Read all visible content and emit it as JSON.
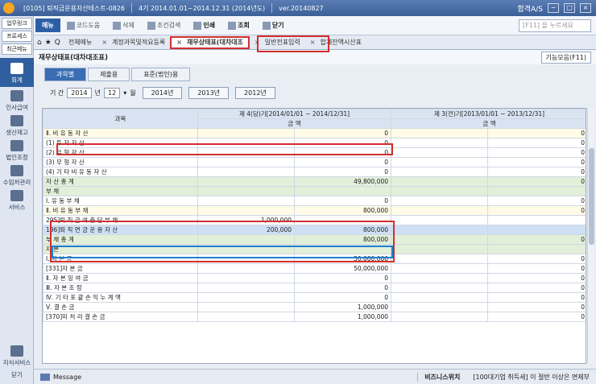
{
  "titlebar": {
    "company": "[0105] 퇴직금운용자산테스트-0826",
    "period": "4기 2014.01.01~2014.12.31 (2014년도)",
    "version": "ver.20140827",
    "right": "합격A/S"
  },
  "sidebar": {
    "top_buttons": [
      "업무링크",
      "프로세스",
      "최근메뉴"
    ],
    "items": [
      "회계",
      "인사급여",
      "생산재고",
      "법인조정",
      "수임처관리",
      "서비스"
    ],
    "bottom": [
      "지식서비스",
      "닫기"
    ]
  },
  "toolbar": {
    "menu": "메뉴",
    "items": [
      "코드도움",
      "삭제",
      "조건검색",
      "인쇄",
      "조회",
      "닫기"
    ],
    "search_placeholder": "[F11] 을 누르세요"
  },
  "tabs": [
    "전체메뉴",
    "계정과목및적요등록",
    "재무상태표(대차대조",
    "일반전표입력",
    "합계잔액시산표"
  ],
  "content": {
    "title": "재무상태표(대차대조표)",
    "func": "기능모음(F11)",
    "subtabs": [
      "과목별",
      "제출용",
      "표준(법인)용"
    ]
  },
  "period": {
    "label": "기   간",
    "year": "2014",
    "year_unit": "년",
    "month": "12",
    "month_unit": "월",
    "years": [
      "2014년",
      "2013년",
      "2012년"
    ]
  },
  "grid": {
    "headers": {
      "account": "과목",
      "cur": "제 4(당)기[2014/01/01 ~ 2014/12/31]",
      "prev": "제 3(전)기[2013/01/01 ~ 2013/12/31]",
      "amt": "금                  액"
    },
    "rows": [
      {
        "acct": "Ⅱ. 비   유   동   자   산",
        "a1": "",
        "a2": "0",
        "b2": "0",
        "cls": "sec"
      },
      {
        "acct": "(1) 투    자    자    산",
        "a1": "",
        "a2": "0",
        "b2": "0",
        "cls": ""
      },
      {
        "acct": "(2) 유    형    자    산",
        "a1": "",
        "a2": "0",
        "b2": "0",
        "cls": ""
      },
      {
        "acct": "(3) 무    형    자    산",
        "a1": "",
        "a2": "0",
        "b2": "0",
        "cls": ""
      },
      {
        "acct": "(4) 기 타 비 유 동 자 산",
        "a1": "",
        "a2": "0",
        "b2": "0",
        "cls": ""
      },
      {
        "acct": "자      산      총      계",
        "a1": "",
        "a2": "49,800,000",
        "b2": "0",
        "cls": "green"
      },
      {
        "acct": "부                          채",
        "a1": "",
        "a2": "",
        "b2": "",
        "cls": "green"
      },
      {
        "acct": "Ⅰ. 유      동      부      채",
        "a1": "",
        "a2": "0",
        "b2": "0",
        "cls": ""
      },
      {
        "acct": "Ⅱ. 비    유    동    부    채",
        "a1": "",
        "a2": "800,000",
        "b2": "0",
        "cls": "sec"
      },
      {
        "acct": "295]퇴 직 급 여 충 당 부 채",
        "a1": "1,000,000",
        "a2": "",
        "b2": "",
        "cls": ""
      },
      {
        "acct": "186]퇴 직 연 금 운 용 자 산",
        "a1": "200,000",
        "a2": "800,000",
        "b2": "",
        "cls": "sel"
      },
      {
        "acct": "부      채      총      계",
        "a1": "",
        "a2": "800,000",
        "b2": "0",
        "cls": "green"
      },
      {
        "acct": "자                          본",
        "a1": "",
        "a2": "",
        "b2": "",
        "cls": "green"
      },
      {
        "acct": "Ⅰ. 자            본            금",
        "a1": "",
        "a2": "50,000,000",
        "b2": "0",
        "cls": ""
      },
      {
        "acct": "[331]자           본           금",
        "a1": "",
        "a2": "50,000,000",
        "b2": "0",
        "cls": ""
      },
      {
        "acct": "Ⅱ. 자   본   잉   여   금",
        "a1": "",
        "a2": "0",
        "b2": "0",
        "cls": ""
      },
      {
        "acct": "Ⅲ. 자      본      조      정",
        "a1": "",
        "a2": "0",
        "b2": "0",
        "cls": ""
      },
      {
        "acct": "Ⅳ. 기 타 포 괄 손 익 누 계 액",
        "a1": "",
        "a2": "0",
        "b2": "0",
        "cls": ""
      },
      {
        "acct": "Ⅴ. 결           손           금",
        "a1": "",
        "a2": "1,000,000",
        "b2": "0",
        "cls": ""
      },
      {
        "acct": "[370]미  처  리  결  손  금",
        "a1": "",
        "a2": "1,000,000",
        "b2": "0",
        "cls": ""
      }
    ]
  },
  "bottom": {
    "message": "Message",
    "biz": "비즈니스위치",
    "notice": "[100대기업 취득세] 이 절반 이상은 면제부"
  }
}
